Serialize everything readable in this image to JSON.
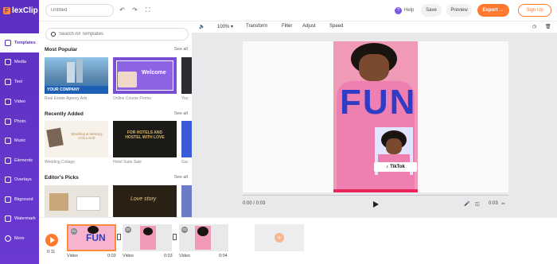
{
  "app": {
    "brand_letter": "F",
    "brand_name": "lexClip"
  },
  "topbar": {
    "title_placeholder": "Untitled",
    "help_label": "Help",
    "save_label": "Save",
    "preview_label": "Preview",
    "export_label": "Export",
    "export_arrow": "→",
    "signup_label": "Sign Up"
  },
  "sidebar": {
    "items": [
      {
        "label": "Templates",
        "icon": "templates-icon"
      },
      {
        "label": "Media",
        "icon": "media-icon"
      },
      {
        "label": "Text",
        "icon": "text-icon"
      },
      {
        "label": "Video",
        "icon": "video-icon"
      },
      {
        "label": "Photo",
        "icon": "photo-icon"
      },
      {
        "label": "Music",
        "icon": "music-icon"
      },
      {
        "label": "Elements",
        "icon": "elements-icon"
      },
      {
        "label": "Overlays",
        "icon": "overlays-icon"
      },
      {
        "label": "Bkground",
        "icon": "background-icon"
      },
      {
        "label": "Watermark",
        "icon": "watermark-icon"
      },
      {
        "label": "More",
        "icon": "more-icon"
      }
    ]
  },
  "panel": {
    "search_placeholder": "Search All Templates",
    "see_all": "See all",
    "sections": [
      {
        "title": "Most Popular",
        "thumb_texts": [
          "YOUR COMPANY",
          "Welcome",
          ""
        ],
        "captions": [
          "Real Estate Agency Ads",
          "Online Course Promo",
          "You"
        ]
      },
      {
        "title": "Recently Added",
        "thumb_texts": [
          "Wedding & Memory COLLAGE",
          "FOR HOTELS AND HOSTEL WITH LOVE",
          ""
        ],
        "captions": [
          "Wedding Collage",
          "Hotel Suite Sale",
          "Gar"
        ]
      },
      {
        "title": "Editor's Picks",
        "thumb_texts": [
          "",
          "Love story",
          ""
        ],
        "captions": [
          "",
          "",
          ""
        ]
      }
    ]
  },
  "editor_toolbar": {
    "zoom": "100%",
    "zoom_caret": "▾",
    "transform": "Transform",
    "filter": "Filter",
    "adjust": "Adjust",
    "speed": "Speed"
  },
  "canvas": {
    "headline": "FUN",
    "badge": "TikTok",
    "time_current": "0:00 / 0:03",
    "time_end": "0:03"
  },
  "timeline": {
    "playhead_time": "0:11",
    "clips": [
      {
        "num": "01",
        "label": "Video",
        "duration": "0:03",
        "thumb_text": "FUN"
      },
      {
        "num": "02",
        "label": "Video",
        "duration": "0:03",
        "thumb_text": ""
      },
      {
        "num": "03",
        "label": "Video",
        "duration": "0:04",
        "thumb_text": ""
      }
    ],
    "add_symbol": "+"
  },
  "colors": {
    "brand_purple": "#5b2fc0",
    "accent_orange": "#ff7a2f",
    "headline_blue": "#2f3dc6",
    "video_pink": "#f19ab7"
  }
}
